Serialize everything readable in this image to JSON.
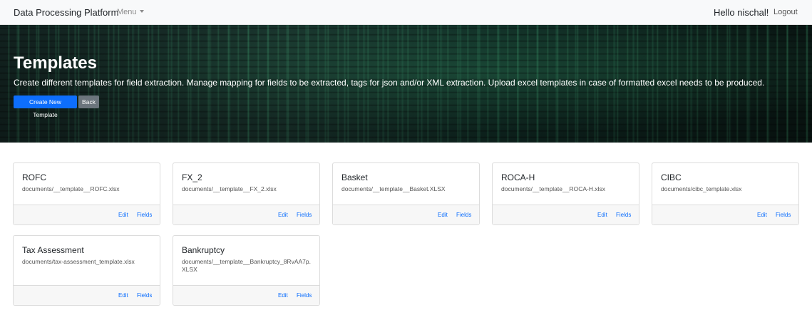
{
  "navbar": {
    "brand": "Data Processing Platform",
    "menu_label": "Menu",
    "greeting": "Hello nischal!",
    "logout_label": "Logout"
  },
  "hero": {
    "title": "Templates",
    "description": "Create different templates for field extraction. Manage mapping for fields to be extracted, tags for json and/or XML extraction. Upload excel templates in case of formatted excel needs to be produced.",
    "create_button": "Create New Template",
    "back_button": "Back"
  },
  "card_actions": {
    "edit": "Edit",
    "fields": "Fields"
  },
  "templates": [
    {
      "name": "ROFC",
      "path": "documents/__template__ROFC.xlsx"
    },
    {
      "name": "FX_2",
      "path": "documents/__template__FX_2.xlsx"
    },
    {
      "name": "Basket",
      "path": "documents/__template__Basket.XLSX"
    },
    {
      "name": "ROCA-H",
      "path": "documents/__template__ROCA-H.xlsx"
    },
    {
      "name": "CIBC",
      "path": "documents/cibc_template.xlsx"
    },
    {
      "name": "Tax Assessment",
      "path": "documents/tax-assessment_template.xlsx"
    },
    {
      "name": "Bankruptcy",
      "path": "documents/__template__Bankruptcy_8RvAA7p.XLSX"
    }
  ],
  "colors": {
    "primary": "#0d6efd",
    "secondary": "#6c757d",
    "navbar_bg": "#f8f9fa"
  }
}
